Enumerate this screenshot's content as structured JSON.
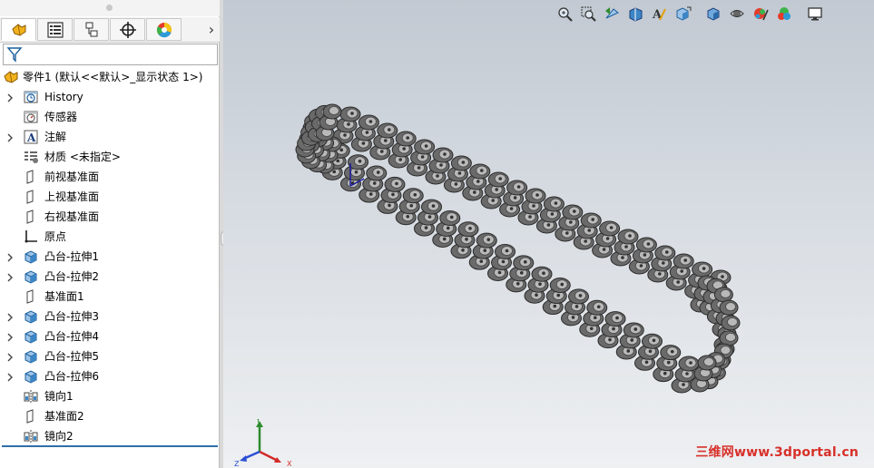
{
  "panel": {
    "tabs": [
      {
        "icon": "feature-manager-icon",
        "active": true
      },
      {
        "icon": "property-manager-icon",
        "active": false
      },
      {
        "icon": "configuration-manager-icon",
        "active": false
      },
      {
        "icon": "dimxpert-icon",
        "active": false
      },
      {
        "icon": "display-manager-icon",
        "active": false
      }
    ],
    "more_tabs_glyph": "›"
  },
  "tree": {
    "root_label": "零件1  (默认<<默认>_显示状态 1>)",
    "items": [
      {
        "label": "History",
        "icon": "history-icon",
        "expandable": true
      },
      {
        "label": "传感器",
        "icon": "sensors-icon",
        "expandable": false
      },
      {
        "label": "注解",
        "icon": "annotations-icon",
        "expandable": true
      },
      {
        "label": "材质 <未指定>",
        "icon": "material-icon",
        "expandable": false
      },
      {
        "label": "前视基准面",
        "icon": "plane-icon",
        "expandable": false
      },
      {
        "label": "上视基准面",
        "icon": "plane-icon",
        "expandable": false
      },
      {
        "label": "右视基准面",
        "icon": "plane-icon",
        "expandable": false
      },
      {
        "label": "原点",
        "icon": "origin-icon",
        "expandable": false
      },
      {
        "label": "凸台-拉伸1",
        "icon": "extrude-icon",
        "expandable": true
      },
      {
        "label": "凸台-拉伸2",
        "icon": "extrude-icon",
        "expandable": true
      },
      {
        "label": "基准面1",
        "icon": "plane-icon",
        "expandable": false
      },
      {
        "label": "凸台-拉伸3",
        "icon": "extrude-icon",
        "expandable": true
      },
      {
        "label": "凸台-拉伸4",
        "icon": "extrude-icon",
        "expandable": true
      },
      {
        "label": "凸台-拉伸5",
        "icon": "extrude-icon",
        "expandable": true
      },
      {
        "label": "凸台-拉伸6",
        "icon": "extrude-icon",
        "expandable": true
      },
      {
        "label": "镜向1",
        "icon": "mirror-icon",
        "expandable": false
      },
      {
        "label": "基准面2",
        "icon": "plane-icon",
        "expandable": false
      },
      {
        "label": "镜向2",
        "icon": "mirror-icon",
        "expandable": false
      }
    ]
  },
  "view_toolbar": [
    "zoom-to-fit-icon",
    "zoom-to-area-icon",
    "previous-view-icon",
    "section-view-icon",
    "dynamic-annotation-view-icon",
    "view-orientation-icon",
    "display-style-icon",
    "hide-show-items-icon",
    "edit-appearance-icon",
    "apply-scene-icon",
    "view-settings-icon"
  ],
  "triad": {
    "x": "X",
    "y": "Y",
    "z": "Z"
  },
  "watermark": "三维网www.3dportal.cn",
  "colors": {
    "accent": "#2f6fa8",
    "feature_blue": "#3d86c6",
    "plate": "#6a6a6a",
    "roller": "#b9b9b9",
    "watermark": "#d8302a"
  }
}
